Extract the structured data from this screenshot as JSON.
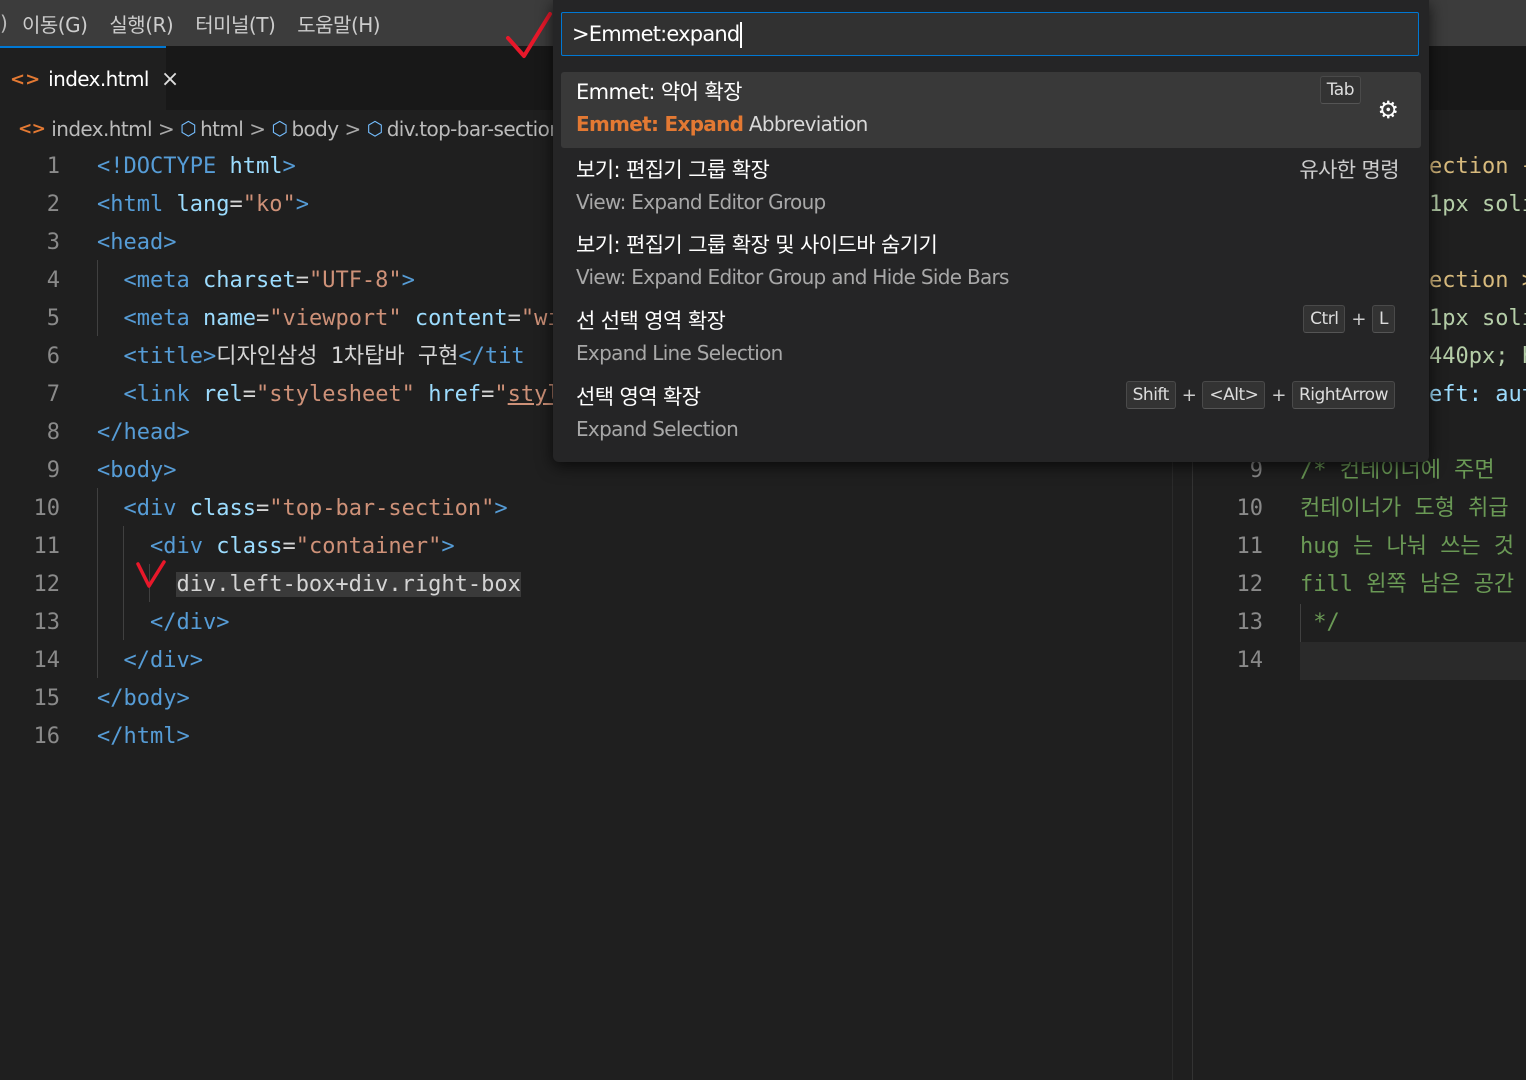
{
  "menubar": {
    "edge_glyph": ")",
    "items": [
      "이동(G)",
      "실행(R)",
      "터미널(T)",
      "도움말(H)"
    ]
  },
  "tab": {
    "icon": "<>",
    "name": "index.html",
    "close_glyph": "×"
  },
  "breadcrumb": {
    "file_icon": "<>",
    "file": "index.html",
    "items": [
      "html",
      "body",
      "div.top-bar-section"
    ],
    "sep": ">"
  },
  "editor_left": {
    "line_numbers": [
      "1",
      "2",
      "3",
      "4",
      "5",
      "6",
      "7",
      "8",
      "9",
      "10",
      "11",
      "12",
      "13",
      "14",
      "15",
      "16"
    ],
    "line12_text": "div.left-box+div.right-box"
  },
  "editor_right": {
    "line_numbers": [
      "9",
      "10",
      "11",
      "12",
      "13",
      "14"
    ],
    "lines": [
      "/* 컨테이너에 주면",
      "컨테이너가 도형 취급",
      "hug 는 나눠 쓰는 것",
      "fill 왼쪽 남은 공간",
      " */",
      ""
    ],
    "behind_palette": [
      "ection {",
      "1px soli",
      "ection >",
      "1px soli",
      "440px; h",
      "eft: aut"
    ]
  },
  "command_palette": {
    "input_value": ">Emmet:expand",
    "items": [
      {
        "title": "Emmet: 약어 확장",
        "subtitle_match": "Emmet: Expand",
        "subtitle_rest": " Abbreviation",
        "keybinding": [
          "Tab"
        ],
        "active": true
      },
      {
        "title": "보기: 편집기 그룹 확장",
        "subtitle": "View: Expand Editor Group",
        "right_label": "유사한 명령"
      },
      {
        "title": "보기: 편집기 그룹 확장 및 사이드바 숨기기",
        "subtitle": "View: Expand Editor Group and Hide Side Bars"
      },
      {
        "title": "선 선택 영역 확장",
        "subtitle": "Expand Line Selection",
        "keybinding": [
          "Ctrl",
          "L"
        ]
      },
      {
        "title": "선택 영역 확장",
        "subtitle": "Expand Selection",
        "keybinding": [
          "Shift",
          "<Alt>",
          "RightArrow"
        ]
      }
    ],
    "plus": "+",
    "gear_glyph": "⚙"
  },
  "colors": {
    "accent": "#0078d4",
    "match": "#e37933",
    "annotation": "#e8182a"
  }
}
